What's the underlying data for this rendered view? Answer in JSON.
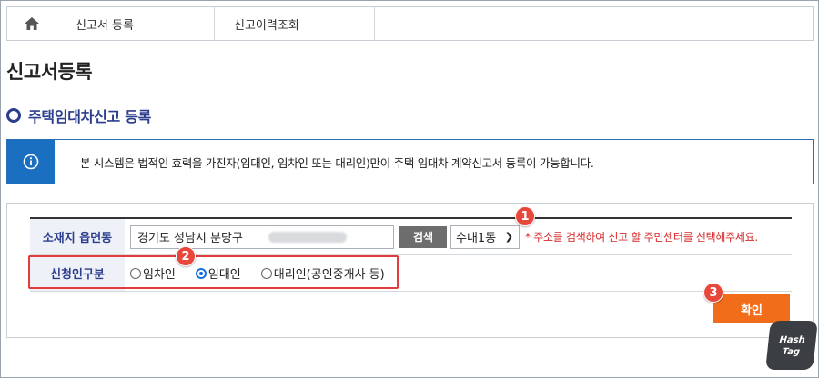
{
  "nav": {
    "home_icon": "home-icon",
    "crumbs": [
      "신고서 등록",
      "신고이력조회"
    ]
  },
  "page_title": "신고서등록",
  "section_title": "주택임대차신고 등록",
  "notice": {
    "icon": "info-icon",
    "text": "본 시스템은 법적인 효력을 가진자(임대인, 임차인 또는 대리인)만이 주택 임대차 계약신고서 등록이 가능합니다."
  },
  "form": {
    "address_label": "소재지 읍면동",
    "address_value": "경기도 성남시 분당구",
    "search_button": "검색",
    "dong_select": "수내1동",
    "hint": "* 주소를 검색하여 신고 할 주민센터를 선택해주세요.",
    "applicant_label": "신청인구분",
    "radios": [
      {
        "label": "임차인",
        "checked": false
      },
      {
        "label": "임대인",
        "checked": true
      },
      {
        "label": "대리인(공인중개사 등)",
        "checked": false
      }
    ]
  },
  "confirm_button": "확인",
  "steps": [
    "1",
    "2",
    "3"
  ],
  "watermark": "Hash Tag",
  "colors": {
    "accent": "#2b3d8e",
    "info": "#1a6fc0",
    "confirm": "#f26d1a",
    "hint": "#d62b2b",
    "step_badge": "#e8473b"
  }
}
